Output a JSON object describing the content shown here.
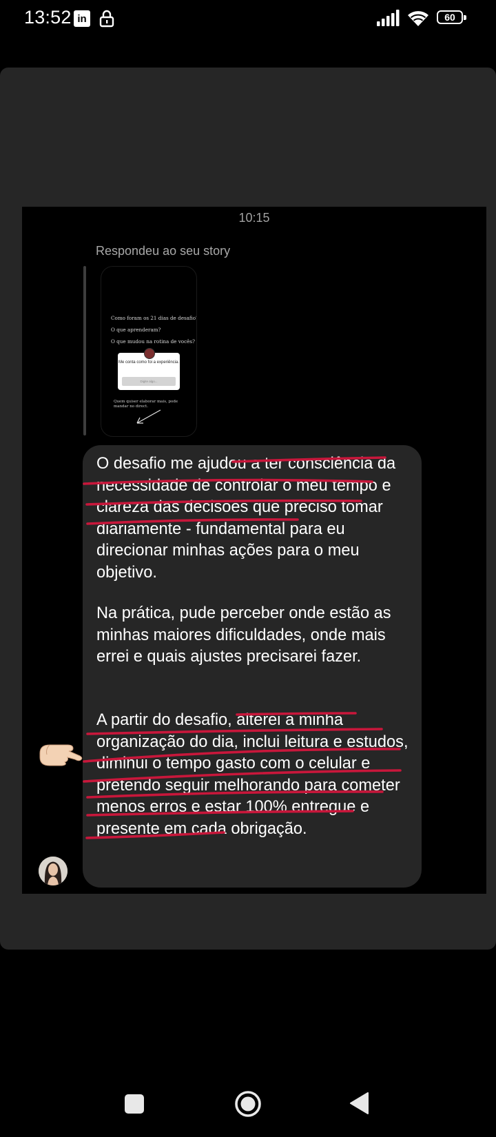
{
  "status_bar": {
    "time": "13:52",
    "linkedin_glyph": "in",
    "battery_level": "60",
    "icons": [
      "linkedin-icon",
      "lock-icon",
      "signal-icon",
      "wifi-icon",
      "battery-icon"
    ]
  },
  "chat": {
    "time": "10:15",
    "reply_label": "Respondeu ao seu story",
    "story": {
      "q1": "Como foram os 21 dias de desafio?",
      "q2": "O que aprenderam?",
      "q3": "O que mudou na rotina de vocês?",
      "box_text": "Me conta como foi a experiência.",
      "box_placeholder": "Digite algo...",
      "footer": "Quem quiser elaborar mais, pode mandar no direct."
    },
    "message": {
      "p1": "O desafio me ajudou a ter consciência da necessidade de controlar o meu tempo e clareza das decisões que preciso tomar diariamente - fundamental para eu direcionar minhas ações para o meu objetivo.",
      "p2": "Na prática, pude perceber onde estão as minhas maiores dificuldades, onde mais errei e quais ajustes precisarei fazer.",
      "p3": "A partir do desafio, alterei a minha organização do dia, inclui leitura e estudos, diminui o tempo gasto com o celular e pretendo seguir melhorando para cometer menos erros e estar 100% entregue e presente em cada obrigação."
    },
    "highlight_color": "#c8173b"
  },
  "nav_bar": {
    "buttons": [
      "recents-button",
      "home-button",
      "back-button"
    ]
  }
}
